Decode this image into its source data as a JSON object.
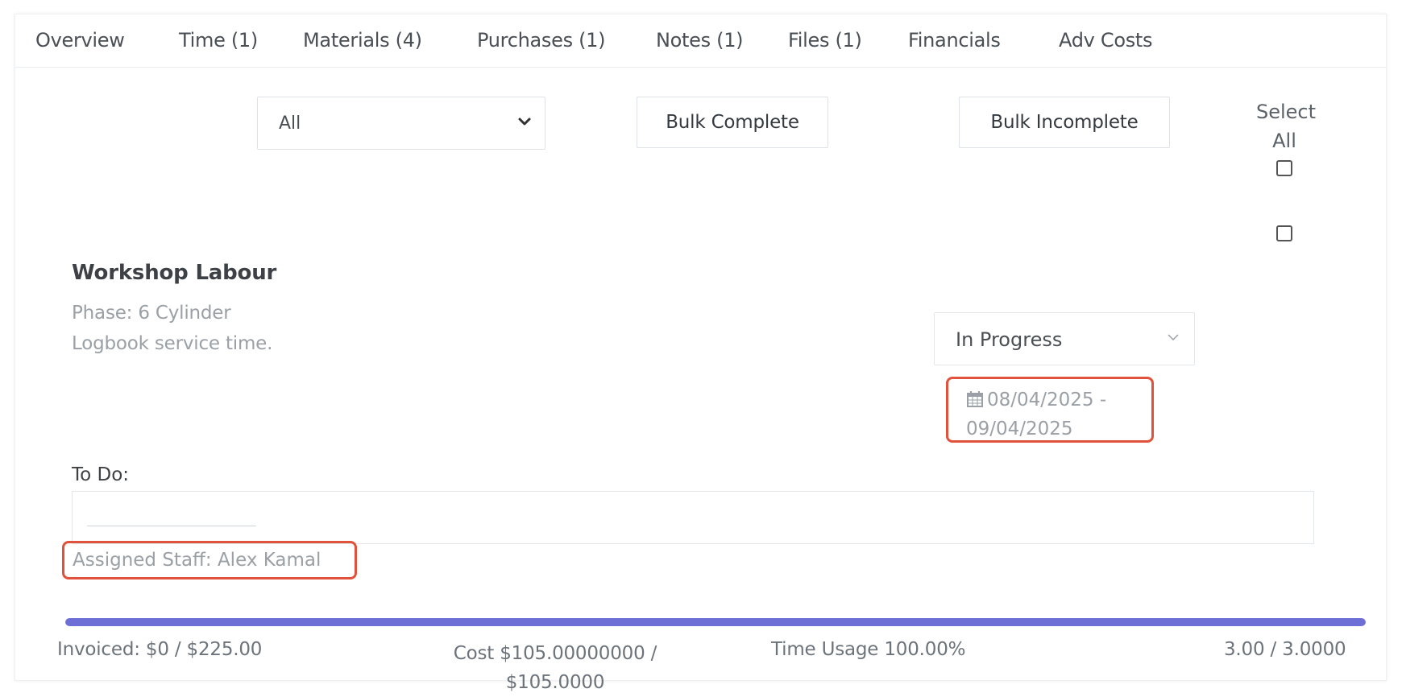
{
  "tabs": [
    {
      "label": "Overview"
    },
    {
      "label": "Time (1)"
    },
    {
      "label": "Materials (4)"
    },
    {
      "label": "Purchases (1)"
    },
    {
      "label": "Notes (1)"
    },
    {
      "label": "Files (1)"
    },
    {
      "label": "Financials"
    },
    {
      "label": "Adv Costs"
    }
  ],
  "toolbar": {
    "filter_value": "All",
    "bulk_complete_label": "Bulk Complete",
    "bulk_incomplete_label": "Bulk Incomplete",
    "select_all_line1": "Select",
    "select_all_line2": "All"
  },
  "item": {
    "title": "Workshop Labour",
    "phase": "Phase: 6 Cylinder",
    "description": "Logbook service time.",
    "status": "In Progress",
    "date_range_line1": "08/04/2025 -",
    "date_range_line2": "09/04/2025",
    "todo_label": "To Do:",
    "assigned_label": "Assigned Staff:",
    "assigned_value": "Alex Kamal"
  },
  "footer": {
    "progress_fraction": 1.0,
    "invoiced": "Invoiced: $0 / $225.00",
    "cost_line1": "Cost $105.00000000 /",
    "cost_line2": "$105.0000",
    "time_usage": "Time Usage 100.00%",
    "hours": "3.00 / 3.0000"
  },
  "colors": {
    "accent": "#6e6fd6",
    "highlight": "#e0523c"
  },
  "icons": {
    "calendar": "calendar-icon",
    "chevron": "chevron-down-icon"
  }
}
